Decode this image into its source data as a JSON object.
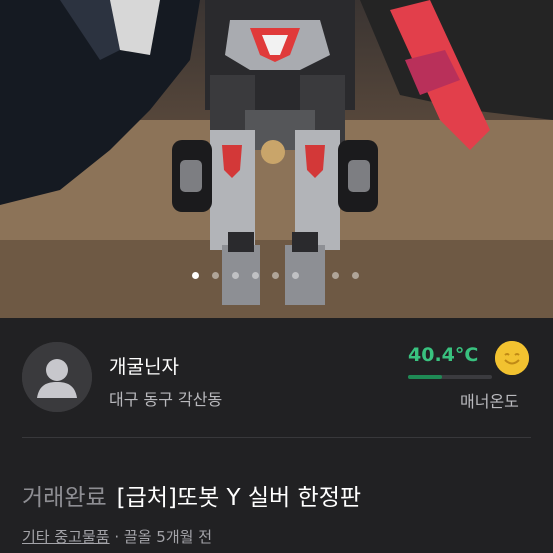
{
  "product_image": {
    "alt_icon": "toy-robot-photo",
    "page_count": 8,
    "active_index": 0
  },
  "seller": {
    "name": "개굴닌자",
    "location": "대구 동구 각산동",
    "manner_temperature": "40.4°C",
    "manner_temperature_value": 40.4,
    "manner_label": "매너온도",
    "temperature_color": "#39c27f"
  },
  "post": {
    "status": "거래완료",
    "title": "[급처]또봇 Y 실버 한정판",
    "category": "기타 중고물품",
    "separator": "·",
    "bump_time": "끌올 5개월 전"
  },
  "colors": {
    "background": "#212123",
    "accent": "#39c27f"
  }
}
